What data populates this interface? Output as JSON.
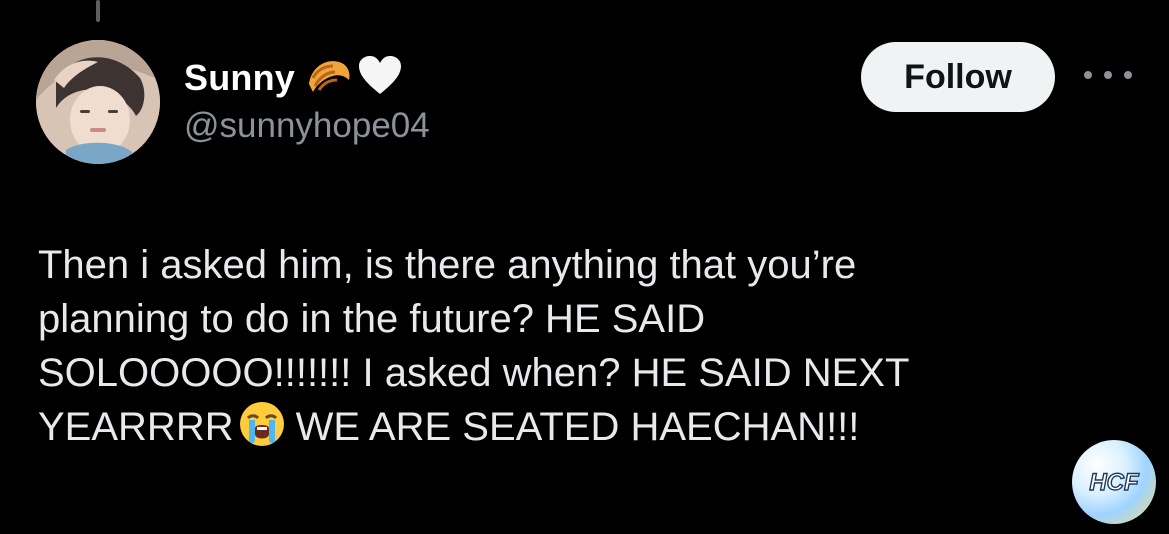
{
  "post": {
    "author": {
      "display_name": "Sunny",
      "handle": "@sunnyhope04",
      "name_emojis": [
        "croissant-emoji",
        "white-heart-emoji"
      ]
    },
    "follow_label": "Follow",
    "more_icon": "more-horizontal-icon",
    "text_lines": [
      "Then i asked him, is there anything that you’re",
      "planning to do in the future? HE SAID",
      "SOLOOOOO!!!!!!! I asked when? HE SAID NEXT"
    ],
    "last_line": {
      "before_emoji": "YEARRRR",
      "emoji": "loudly-crying-face-emoji",
      "after_emoji": "WE ARE SEATED HAECHAN!!!"
    }
  },
  "watermark": {
    "text": "HCF"
  },
  "colors": {
    "background": "#000000",
    "text": "#e7e9ea",
    "secondary_text": "#8b9299",
    "follow_button_bg": "#eff3f4"
  }
}
